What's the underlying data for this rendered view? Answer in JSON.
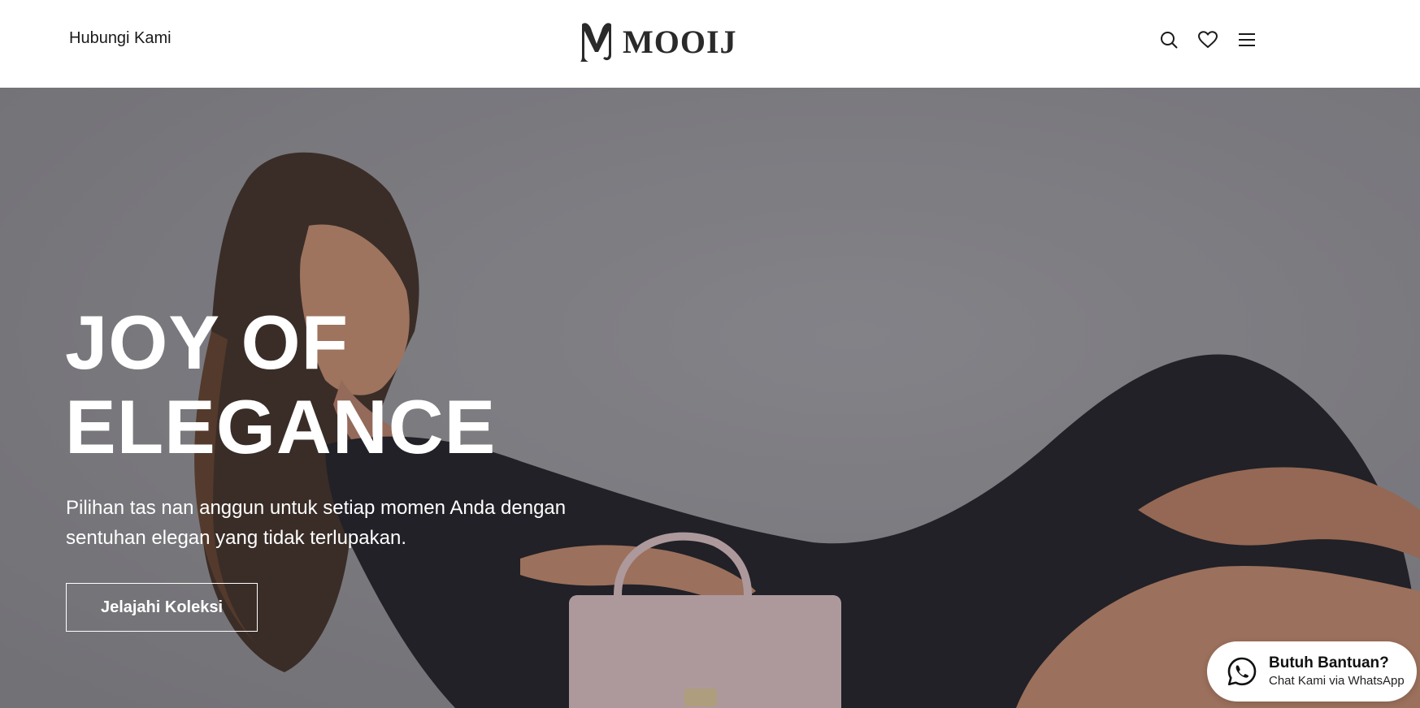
{
  "header": {
    "contact_label": "Hubungi Kami",
    "logo_text": "MOOIJ",
    "icons": [
      "search-icon",
      "heart-icon",
      "menu-icon"
    ]
  },
  "hero": {
    "title_line1": "JOY OF",
    "title_line2": "ELEGANCE",
    "subtitle": "Pilihan tas nan anggun untuk setiap momen Anda dengan sentuhan elegan yang tidak terlupakan.",
    "cta_label": "Jelajahi Koleksi"
  },
  "whatsapp": {
    "title": "Butuh Bantuan?",
    "subtitle": "Chat Kami via WhatsApp",
    "icon": "whatsapp-icon"
  },
  "colors": {
    "hero_bg": "#8a898d",
    "text_dark": "#1a1a1a",
    "white": "#ffffff"
  }
}
